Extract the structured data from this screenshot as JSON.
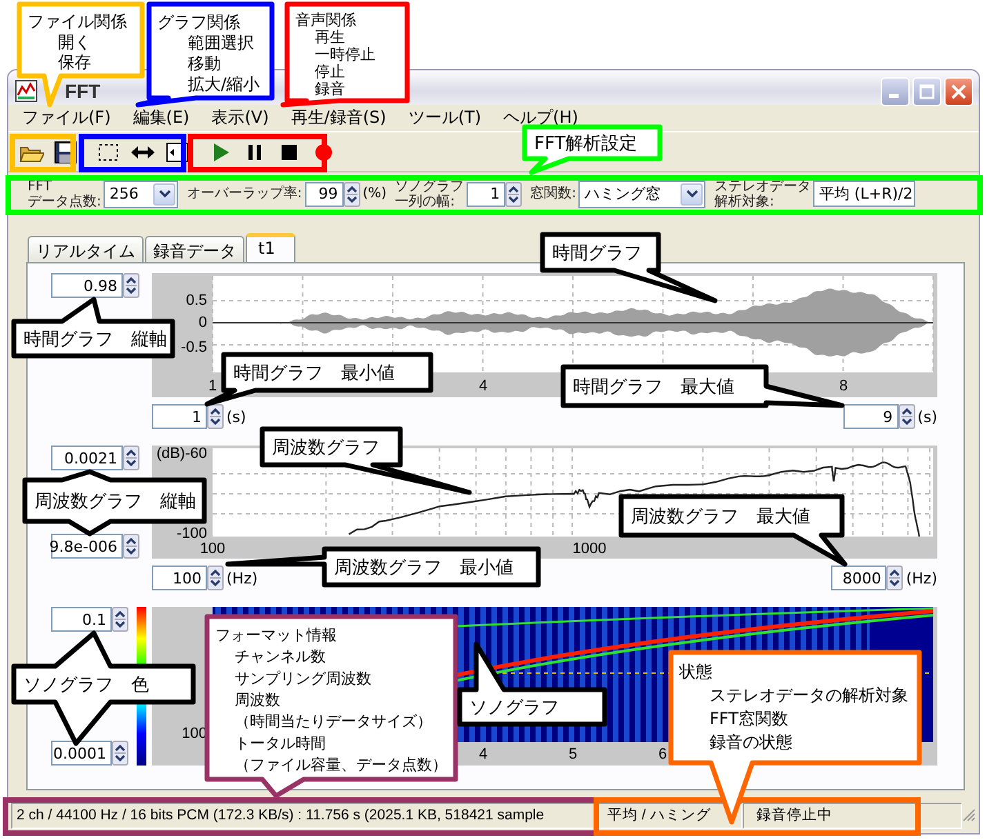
{
  "window": {
    "title": "FFT"
  },
  "menu": [
    "ファイル(F)",
    "編集(E)",
    "表示(V)",
    "再生/録音(S)",
    "ツール(T)",
    "ヘルプ(H)"
  ],
  "settings": [
    {
      "kind": "select",
      "label": "FFT\nデータ点数:",
      "value": "256"
    },
    {
      "kind": "spin",
      "label": "オーバーラップ率:",
      "value": "99",
      "unit": "(%)"
    },
    {
      "kind": "spin",
      "label": "ソノグラフ一列の幅:",
      "value": "1"
    },
    {
      "kind": "select",
      "label": "窓関数:",
      "value": "ハミング窓"
    },
    {
      "kind": "text",
      "label": "ステレオデータ解析対象:",
      "value": "平均 (L+R)/2"
    }
  ],
  "tabs": [
    {
      "label": "リアルタイム",
      "selected": false
    },
    {
      "label": "録音データ",
      "selected": false
    },
    {
      "label": "t1",
      "selected": true
    }
  ],
  "time_graph": {
    "vertical_max": "0.98",
    "y_ticks": [
      "0.5",
      "0",
      "-0.5"
    ],
    "x_ticks": [
      "1",
      "4",
      "8"
    ],
    "range_min": {
      "value": "1",
      "unit": "(s)"
    },
    "range_max": {
      "value": "9",
      "unit": "(s)"
    }
  },
  "frequency_graph": {
    "vertical_max": "0.0021",
    "vertical_min": "9.8e-006",
    "y_ticks": [
      "(dB)-60",
      "-100"
    ],
    "x_ticks": [
      "100",
      "1000"
    ],
    "range_min": {
      "value": "100",
      "unit": "(Hz)"
    },
    "range_max": {
      "value": "8000",
      "unit": "(Hz)"
    }
  },
  "sonograph": {
    "color_max": "0.1",
    "color_min": "0.0001",
    "y_ticks": [
      "100"
    ],
    "x_ticks": [
      "4",
      "5",
      "6"
    ]
  },
  "status_bar": [
    "2 ch / 44100 Hz / 16 bits PCM (172.3 KB/s) : 11.756 s (2025.1 KB, 518421 sample",
    "平均 / ハミング",
    "録音停止中"
  ],
  "callouts": [
    {
      "title": "ファイル関係",
      "items": [
        "開く",
        "保存"
      ],
      "color": "#ffc000"
    },
    {
      "title": "グラフ関係",
      "items": [
        "範囲選択",
        "移動",
        "拡大/縮小"
      ],
      "color": "#0000ff"
    },
    {
      "title": "音声関係",
      "items": [
        "再生",
        "一時停止",
        "停止",
        "録音"
      ],
      "color": "#ff0000"
    },
    {
      "title": "FFT解析設定",
      "color": "#00ff00"
    },
    {
      "title": "時間グラフ",
      "color": "#000000"
    },
    {
      "title": "時間グラフ　縦軸",
      "color": "#000000"
    },
    {
      "title": "時間グラフ　最小値",
      "color": "#000000"
    },
    {
      "title": "時間グラフ　最大値",
      "color": "#000000"
    },
    {
      "title": "周波数グラフ",
      "color": "#000000"
    },
    {
      "title": "周波数グラフ　縦軸",
      "color": "#000000"
    },
    {
      "title": "周波数グラフ　最大値",
      "color": "#000000"
    },
    {
      "title": "周波数グラフ　最小値",
      "color": "#000000"
    },
    {
      "title": "ソノグラフ　色",
      "color": "#000000"
    },
    {
      "title": "フォーマット情報",
      "items": [
        "チャンネル数",
        "サンプリング周波数",
        "周波数",
        "（時間当たりデータサイズ）",
        "トータル時間",
        "（ファイル容量、データ点数）"
      ],
      "color": "#993366"
    },
    {
      "title": "ソノグラフ",
      "color": "#000000"
    },
    {
      "title": "状態",
      "items": [
        "ステレオデータの解析対象",
        "FFT窓関数",
        "録音の状態"
      ],
      "color": "#ff6600"
    }
  ]
}
